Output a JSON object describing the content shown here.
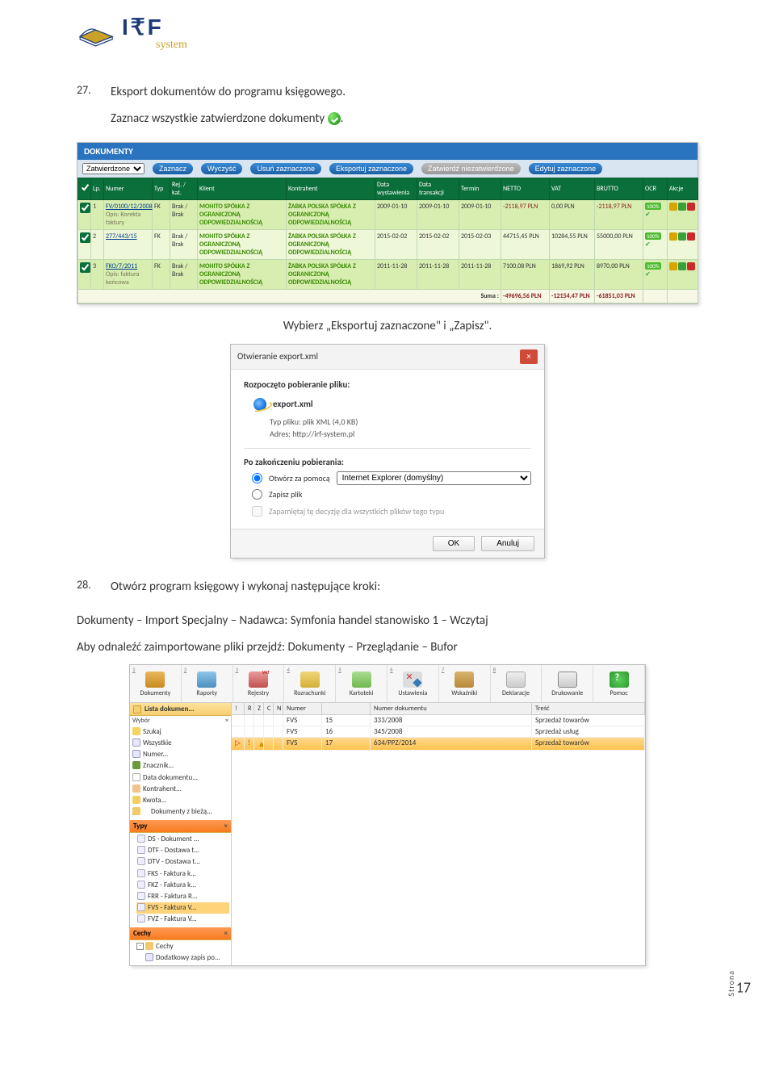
{
  "logo": {
    "main": "I₹F",
    "sub": "system"
  },
  "item27": {
    "num": "27.",
    "title": "Eksport dokumentów do programu księgowego.",
    "line1_prefix": "Zaznacz wszystkie zatwierdzone dokumenty ",
    "line1_suffix": ".",
    "line2": "Wybierz „Eksportuj zaznaczone\" i „Zapisz\"."
  },
  "dokShot": {
    "header": "DOKUMENTY",
    "statusSelect": "Zatwierdzone",
    "buttons": {
      "zaznacz": "Zaznacz",
      "wyczysc": "Wyczyść",
      "usun": "Usuń zaznaczone",
      "eksport": "Eksportuj zaznaczone",
      "zatw": "Zatwierdź niezatwierdzone",
      "edytuj": "Edytuj zaznaczone"
    },
    "cols": [
      "",
      "Lp.",
      "Numer",
      "Typ",
      "Rej. / kat.",
      "Klient",
      "Kontrahent",
      "Data wystawienia",
      "Data transakcji",
      "Termin",
      "NETTO",
      "VAT",
      "BRUTTO",
      "OCR",
      "Akcje"
    ],
    "rows": [
      {
        "lp": "1",
        "numer": "FV/0100/12/2008",
        "numerOpis": "Opis: Korekta faktury",
        "typ": "FK",
        "rej": "Brak / Brak",
        "klient": "MOHITO SPÓŁKA Z OGRANICZONĄ ODPOWIEDZIALNOŚCIĄ",
        "kontr": "ŻABKA POLSKA SPÓŁKA Z OGRANICZONĄ ODPOWIEDZIALNOŚCIĄ",
        "dwyst": "2009-01-10",
        "dtr": "2009-01-10",
        "term": "2009-01-10",
        "netto": "-2118,97 PLN",
        "vat": "0,00 PLN",
        "brutto": "-2118,97 PLN",
        "ocr": "100%"
      },
      {
        "lp": "2",
        "numer": "277/443/15",
        "numerOpis": "",
        "typ": "FK",
        "rej": "Brak / Brak",
        "klient": "MOHITO SPÓŁKA Z OGRANICZONĄ ODPOWIEDZIALNOŚCIĄ",
        "kontr": "ŻABKA POLSKA SPÓŁKA Z OGRANICZONĄ ODPOWIEDZIALNOŚCIĄ",
        "dwyst": "2015-02-02",
        "dtr": "2015-02-02",
        "term": "2015-02-03",
        "netto": "44715,45 PLN",
        "vat": "10284,55 PLN",
        "brutto": "55000,00 PLN",
        "ocr": "100%"
      },
      {
        "lp": "3",
        "numer": "FKO/7/2011",
        "numerOpis": "Opis: faktura końcowa",
        "typ": "FK",
        "rej": "Brak / Brak",
        "klient": "MOHITO SPÓŁKA Z OGRANICZONĄ ODPOWIEDZIALNOŚCIĄ",
        "kontr": "ŻABKA POLSKA SPÓŁKA Z OGRANICZONĄ ODPOWIEDZIALNOŚCIĄ",
        "dwyst": "2011-11-28",
        "dtr": "2011-11-28",
        "term": "2011-11-28",
        "netto": "7100,08 PLN",
        "vat": "1869,92 PLN",
        "brutto": "8970,00 PLN",
        "ocr": "100%"
      }
    ],
    "sum": {
      "label": "Suma :",
      "netto": "-49696,56 PLN",
      "vat": "-12154,47 PLN",
      "brutto": "-61851,03 PLN"
    }
  },
  "dialog": {
    "title": "Otwieranie export.xml",
    "started": "Rozpoczęto pobieranie pliku:",
    "filename": "export.xml",
    "meta1_label": "Typ pliku:",
    "meta1_val": "plik XML (4,0 KB)",
    "meta2_label": "Adres:",
    "meta2_val": "http://irf-system.pl",
    "after": "Po zakończeniu pobierania:",
    "opt1": "Otwórz za pomocą",
    "opt1_sel": "Internet Explorer (domyślny)",
    "opt2": "Zapisz plik",
    "remember": "Zapamiętaj tę decyzję dla wszystkich plików tego typu",
    "ok": "OK",
    "cancel": "Anuluj"
  },
  "item28": {
    "num": "28.",
    "title": "Otwórz program księgowy i wykonaj następujące kroki:",
    "line1": "Dokumenty – Import Specjalny – Nadawca: Symfonia handel stanowisko 1 – Wczytaj",
    "line2": "Aby odnaleźć zaimportowane pliki przejdź: Dokumenty – Przeglądanie – Bufor"
  },
  "sym": {
    "toolbar": [
      {
        "n": "1",
        "label": "Dokumenty",
        "ico": "ico-dok"
      },
      {
        "n": "2",
        "label": "Raporty",
        "ico": "ico-rap"
      },
      {
        "n": "3",
        "label": "Rejestry",
        "ico": "ico-rej"
      },
      {
        "n": "4",
        "label": "Rozrachunki",
        "ico": "ico-roz"
      },
      {
        "n": "5",
        "label": "Kartoteki",
        "ico": "ico-kar"
      },
      {
        "n": "6",
        "label": "Ustawienia",
        "ico": "ico-ust"
      },
      {
        "n": "7",
        "label": "Wskaźniki",
        "ico": "ico-wsk"
      },
      {
        "n": "8",
        "label": "Deklaracje",
        "ico": "ico-dek"
      },
      {
        "n": "",
        "label": "Drukowanie",
        "ico": "ico-druk"
      },
      {
        "n": "",
        "label": "Pomoc",
        "ico": "ico-pom"
      }
    ],
    "leftTitle": "Lista dokumen...",
    "wyborHeader": "Wybór",
    "wyborItems": [
      {
        "ico": "ni-search",
        "t": "Szukaj"
      },
      {
        "ico": "ni-doc",
        "t": "Wszystkie"
      },
      {
        "ico": "ni-doc",
        "t": "Numer..."
      },
      {
        "ico": "ni-flag",
        "t": "Znacznik..."
      },
      {
        "ico": "ni-cal",
        "t": "Data dokumentu..."
      },
      {
        "ico": "ni-person",
        "t": "Kontrahent..."
      },
      {
        "ico": "ni-money",
        "t": "Kwota..."
      },
      {
        "ico": "ni-folder",
        "t": "Dokumenty z bieżą..."
      }
    ],
    "typyHeader": "Typy",
    "typyItems": [
      "DS - Dokument ...",
      "DTF - Dostawa t...",
      "DTV - Dostawa t...",
      "FKS - Faktura k...",
      "FKZ - Faktura k...",
      "FRR - Faktura R...",
      "FVS - Faktura V...",
      "FVZ - Faktura V..."
    ],
    "cechyHeader": "Cechy",
    "cechyItems": [
      "Cechy",
      "Dodatkowy zapis po..."
    ],
    "gridCols": {
      "flag": "!",
      "r": "R",
      "z": "Z",
      "c": "C",
      "n": "N",
      "numer": "Numer",
      "numerdok": "Numer dokumentu",
      "tresc": "Treść"
    },
    "gridRows": [
      {
        "typ": "FVS",
        "nr": "15",
        "dok": "333/2008",
        "tresc": "Sprzedaż towarów"
      },
      {
        "typ": "FVS",
        "nr": "16",
        "dok": "345/2008",
        "tresc": "Sprzedaż usług"
      },
      {
        "typ": "FVS",
        "nr": "17",
        "dok": "634/PPZ/2014",
        "tresc": "Sprzedaż towarów",
        "sel": true,
        "warn": true
      }
    ]
  },
  "footer": {
    "pageLabel": "Strona",
    "pageNum": "17"
  }
}
